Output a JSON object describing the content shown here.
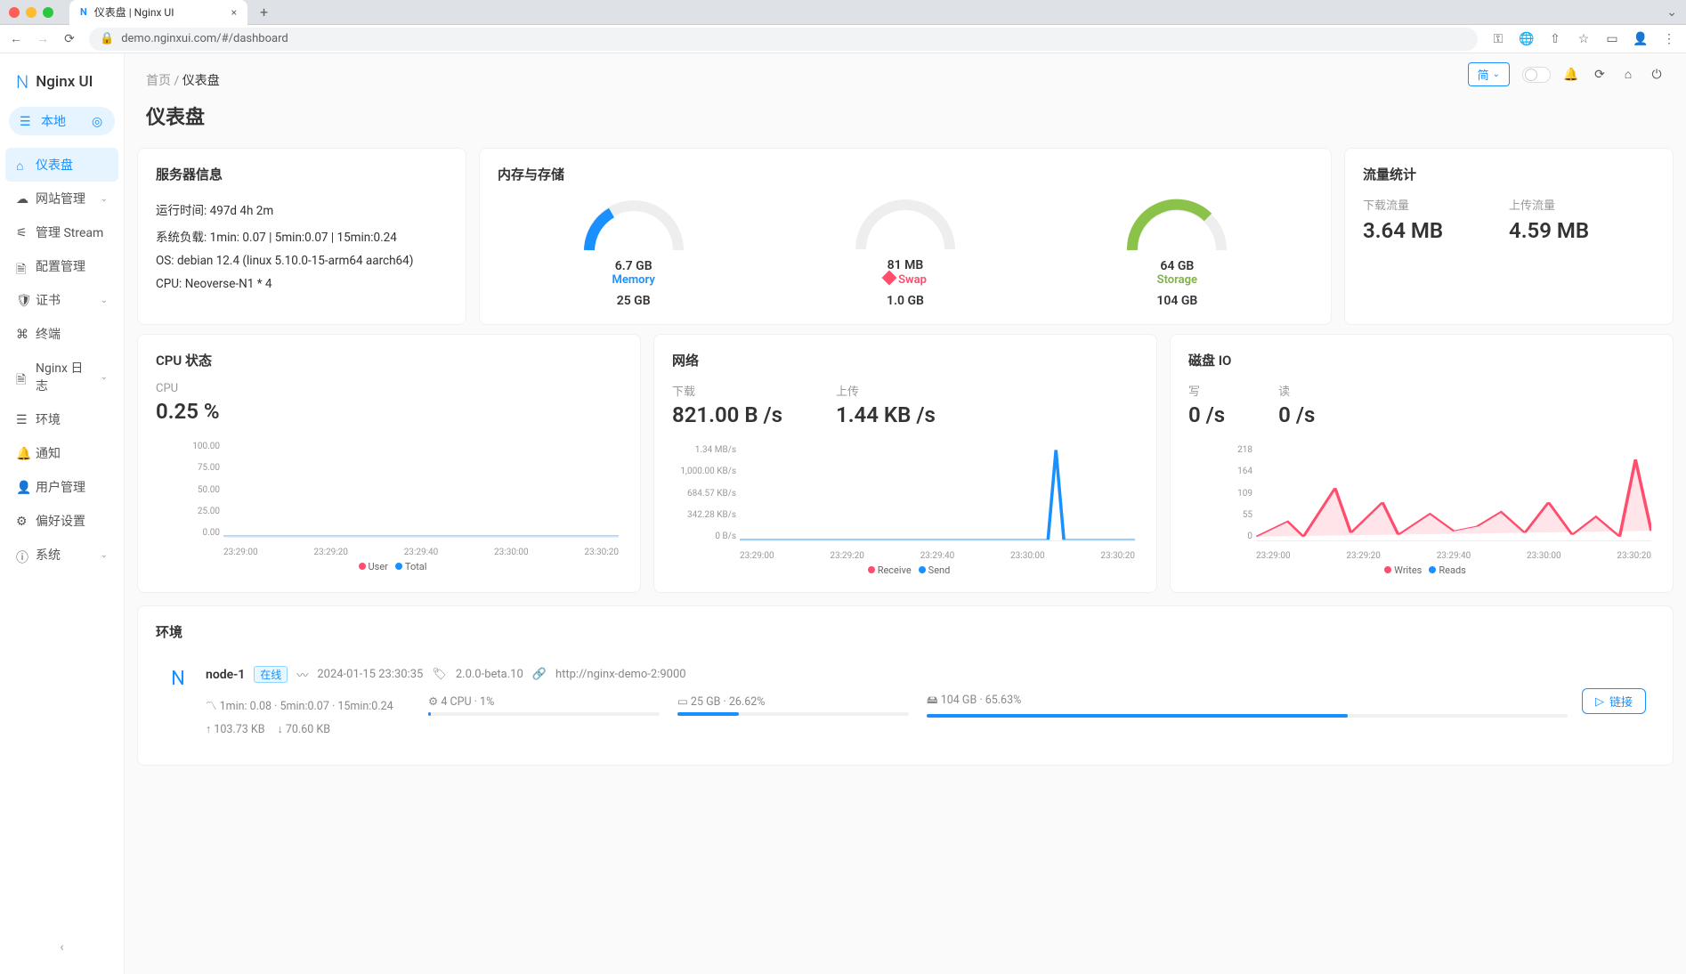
{
  "browser": {
    "tab_title": "仪表盘 | Nginx UI",
    "url": "demo.nginxui.com/#/dashboard"
  },
  "sidebar": {
    "logo": "Nginx UI",
    "local": "本地",
    "items": [
      {
        "label": "仪表盘",
        "icon": "home"
      },
      {
        "label": "网站管理",
        "icon": "cloud",
        "expandable": true
      },
      {
        "label": "管理 Stream",
        "icon": "share"
      },
      {
        "label": "配置管理",
        "icon": "file"
      },
      {
        "label": "证书",
        "icon": "shield",
        "expandable": true
      },
      {
        "label": "终端",
        "icon": "code"
      },
      {
        "label": "Nginx 日志",
        "icon": "file",
        "expandable": true
      },
      {
        "label": "环境",
        "icon": "list"
      },
      {
        "label": "通知",
        "icon": "bell"
      },
      {
        "label": "用户管理",
        "icon": "user"
      },
      {
        "label": "偏好设置",
        "icon": "gear"
      },
      {
        "label": "系统",
        "icon": "info",
        "expandable": true
      }
    ]
  },
  "topbar": {
    "lang": "简"
  },
  "breadcrumb": {
    "home": "首页",
    "current": "仪表盘"
  },
  "page_title": "仪表盘",
  "server_info": {
    "title": "服务器信息",
    "uptime_label": "运行时间:",
    "uptime": "497d 4h 2m",
    "load_label": "系统负载:",
    "load": "1min: 0.07 | 5min:0.07 | 15min:0.24",
    "os_label": "OS:",
    "os": "debian 12.4 (linux 5.10.0-15-arm64 aarch64)",
    "cpu_label": "CPU:",
    "cpu": "Neoverse-N1 * 4"
  },
  "memory_card": {
    "title": "内存与存储",
    "memory": {
      "used": "6.7 GB",
      "label": "Memory",
      "total": "25 GB",
      "pct": 27
    },
    "swap": {
      "used": "81 MB",
      "label": "Swap",
      "total": "1.0 GB",
      "pct": 8
    },
    "storage": {
      "used": "64 GB",
      "label": "Storage",
      "total": "104 GB",
      "pct": 62
    }
  },
  "traffic": {
    "title": "流量统计",
    "down_label": "下载流量",
    "down": "3.64 MB",
    "up_label": "上传流量",
    "up": "4.59 MB"
  },
  "cpu_card": {
    "title": "CPU 状态",
    "label": "CPU",
    "value": "0.25 %",
    "legend_user": "User",
    "legend_total": "Total"
  },
  "net_card": {
    "title": "网络",
    "down_label": "下载",
    "down": "821.00 B /s",
    "up_label": "上传",
    "up": "1.44 KB /s",
    "legend_recv": "Receive",
    "legend_send": "Send"
  },
  "disk_card": {
    "title": "磁盘 IO",
    "write_label": "写",
    "write": "0 /s",
    "read_label": "读",
    "read": "0 /s",
    "legend_writes": "Writes",
    "legend_reads": "Reads"
  },
  "chart_data": {
    "cpu_chart": {
      "type": "area",
      "x_ticks": [
        "23:29:00",
        "23:29:20",
        "23:29:40",
        "23:30:00",
        "23:30:20"
      ],
      "y_ticks": [
        "100.00",
        "75.00",
        "50.00",
        "25.00",
        "0.00"
      ],
      "ylim": [
        0,
        100
      ],
      "series": [
        {
          "name": "User",
          "color": "#ff4d6d",
          "values": [
            0.2,
            0.2,
            0.3,
            0.2,
            0.2,
            0.3,
            0.2,
            0.2,
            0.3,
            0.2
          ]
        },
        {
          "name": "Total",
          "color": "#1890ff",
          "values": [
            0.3,
            0.3,
            0.4,
            0.3,
            0.3,
            0.4,
            0.3,
            0.3,
            0.4,
            0.25
          ]
        }
      ]
    },
    "net_chart": {
      "type": "area",
      "x_ticks": [
        "23:29:00",
        "23:29:20",
        "23:29:40",
        "23:30:00",
        "23:30:20"
      ],
      "y_ticks": [
        "1.34 MB/s",
        "1,000.00 KB/s",
        "684.57 KB/s",
        "342.28 KB/s",
        "0 B/s"
      ],
      "series": [
        {
          "name": "Receive",
          "color": "#ff4d6d",
          "values": [
            0,
            0,
            0,
            0,
            0,
            0,
            0,
            0,
            0,
            0
          ]
        },
        {
          "name": "Send",
          "color": "#1890ff",
          "values": [
            1,
            1,
            1,
            2,
            2,
            1,
            1,
            1370000,
            1,
            1
          ]
        }
      ]
    },
    "disk_chart": {
      "type": "area",
      "x_ticks": [
        "23:29:00",
        "23:29:20",
        "23:29:40",
        "23:30:00",
        "23:30:20"
      ],
      "y_ticks": [
        "218",
        "164",
        "109",
        "55",
        "0"
      ],
      "ylim": [
        0,
        218
      ],
      "series": [
        {
          "name": "Writes",
          "color": "#ff4d6d",
          "values": [
            5,
            40,
            10,
            120,
            20,
            80,
            30,
            60,
            20,
            180
          ]
        },
        {
          "name": "Reads",
          "color": "#1890ff",
          "values": [
            0,
            0,
            0,
            0,
            0,
            0,
            0,
            0,
            0,
            0
          ]
        }
      ]
    }
  },
  "env": {
    "title": "环境",
    "node": {
      "name": "node-1",
      "status": "在线",
      "timestamp": "2024-01-15 23:30:35",
      "version": "2.0.0-beta.10",
      "url": "http://nginx-demo-2:9000",
      "load": "1min: 0.08 · 5min:0.07 · 15min:0.24",
      "cpu": "4 CPU · 1%",
      "mem": "25 GB · 26.62%",
      "mem_pct": 26.62,
      "disk": "104 GB · 65.63%",
      "disk_pct": 65.63,
      "up": "103.73 KB",
      "down": "70.60 KB",
      "link_btn": "链接"
    }
  }
}
